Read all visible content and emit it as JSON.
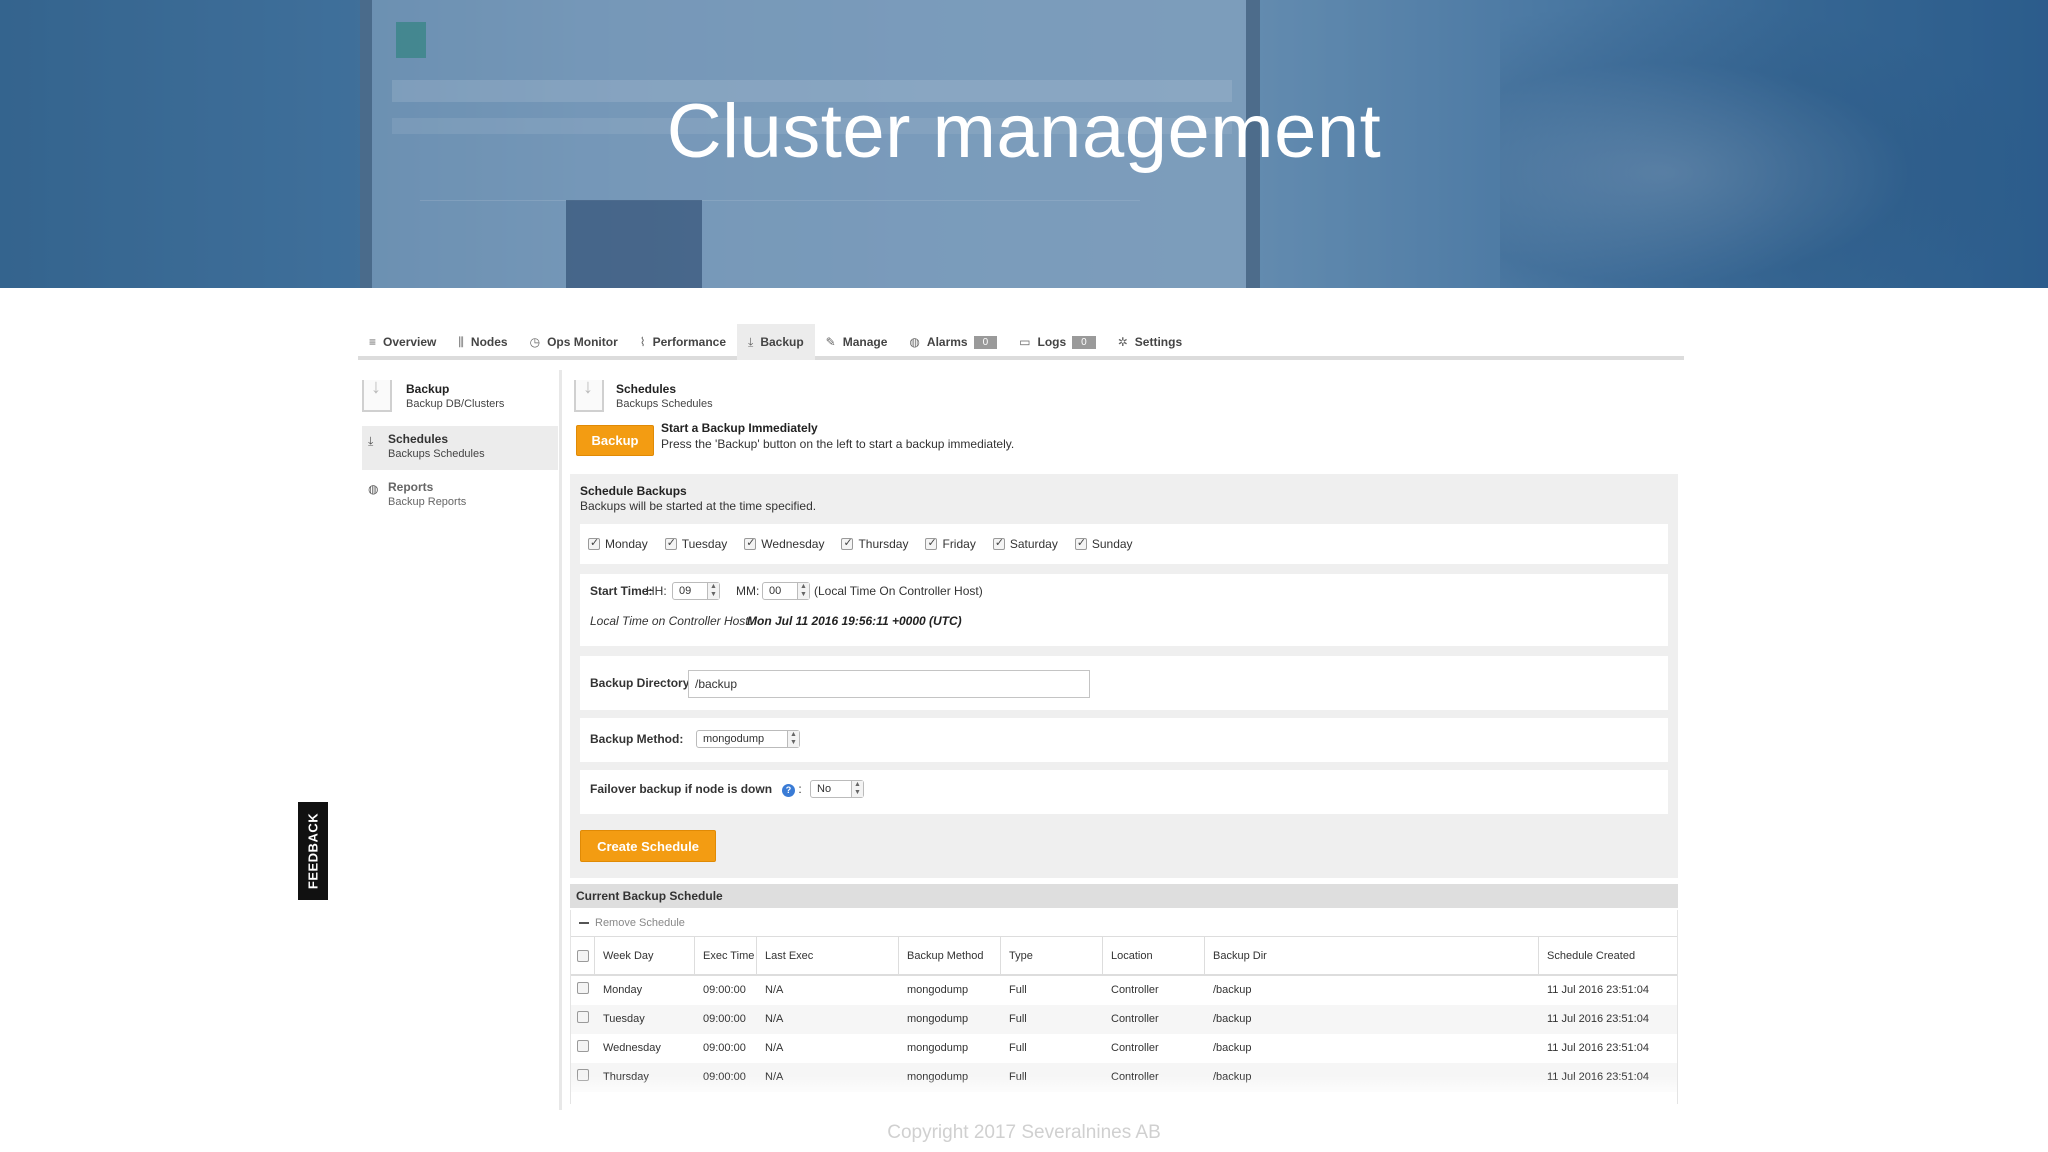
{
  "hero": {
    "title": "Cluster management"
  },
  "tabs": [
    {
      "icon": "≡",
      "label": "Overview"
    },
    {
      "icon": "⫼",
      "label": "Nodes"
    },
    {
      "icon": "◷",
      "label": "Ops Monitor"
    },
    {
      "icon": "⌇",
      "label": "Performance"
    },
    {
      "icon": "⤓",
      "label": "Backup"
    },
    {
      "icon": "✎",
      "label": "Manage"
    },
    {
      "icon": "◍",
      "label": "Alarms",
      "badge": "0"
    },
    {
      "icon": "▭",
      "label": "Logs",
      "badge": "0"
    },
    {
      "icon": "✲",
      "label": "Settings"
    }
  ],
  "sidebar": {
    "header": {
      "title": "Backup",
      "subtitle": "Backup DB/Clusters"
    },
    "items": [
      {
        "title": "Schedules",
        "subtitle": "Backups Schedules"
      },
      {
        "title": "Reports",
        "subtitle": "Backup Reports"
      }
    ]
  },
  "feedback": "FEEDBACK",
  "main": {
    "header": {
      "title": "Schedules",
      "subtitle": "Backups Schedules"
    },
    "backup_button": "Backup",
    "immediate_title": "Start a Backup Immediately",
    "immediate_desc": "Press the 'Backup' button on the left to start a backup immediately.",
    "schedule": {
      "title": "Schedule Backups",
      "desc": "Backups will be started at the time specified.",
      "days": [
        "Monday",
        "Tuesday",
        "Wednesday",
        "Thursday",
        "Friday",
        "Saturday",
        "Sunday"
      ],
      "start_time_label": "Start Time:",
      "hh_label": "HH:",
      "hh_value": "09",
      "mm_label": "MM:",
      "mm_value": "00",
      "tz_note": "(Local Time On Controller Host)",
      "local_time_label": "Local Time on Controller Host:",
      "local_time_value": "Mon Jul 11 2016 19:56:11 +0000 (UTC)",
      "dir_label": "Backup Directory:",
      "dir_value": "/backup",
      "method_label": "Backup Method:",
      "method_value": "mongodump",
      "failover_label": "Failover backup if node is down",
      "failover_value": "No",
      "create_button": "Create Schedule"
    },
    "current": {
      "title": "Current Backup Schedule",
      "remove_label": "Remove Schedule",
      "columns": [
        "Week Day",
        "Exec Time",
        "Last Exec",
        "Backup Method",
        "Type",
        "Location",
        "Backup Dir",
        "Schedule Created"
      ],
      "rows": [
        [
          "Monday",
          "09:00:00",
          "N/A",
          "mongodump",
          "Full",
          "Controller",
          "/backup",
          "11 Jul 2016 23:51:04"
        ],
        [
          "Tuesday",
          "09:00:00",
          "N/A",
          "mongodump",
          "Full",
          "Controller",
          "/backup",
          "11 Jul 2016 23:51:04"
        ],
        [
          "Wednesday",
          "09:00:00",
          "N/A",
          "mongodump",
          "Full",
          "Controller",
          "/backup",
          "11 Jul 2016 23:51:04"
        ],
        [
          "Thursday",
          "09:00:00",
          "N/A",
          "mongodump",
          "Full",
          "Controller",
          "/backup",
          "11 Jul 2016 23:51:04"
        ]
      ]
    }
  },
  "footer": "Copyright 2017 Severalnines AB"
}
